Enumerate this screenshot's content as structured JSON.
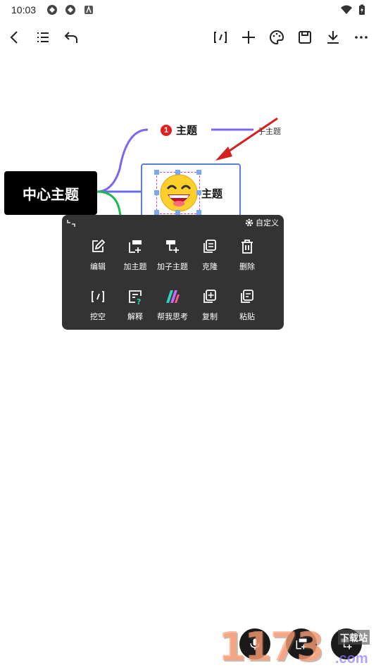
{
  "status_bar": {
    "time": "10:03"
  },
  "mindmap": {
    "central_topic": "中心主题",
    "topic_top": "主题",
    "topic_top_badge": "1",
    "subtopic": "子主题",
    "topic_selected": "主题"
  },
  "context_menu": {
    "customize_label": "自定义",
    "row1": [
      "编辑",
      "加主题",
      "加子主题",
      "克隆",
      "删除"
    ],
    "row2": [
      "挖空",
      "解释",
      "帮我思考",
      "复制",
      "粘贴"
    ]
  },
  "watermark": {
    "text": "1173",
    "site": "下载站",
    "domain": ".com"
  },
  "colors": {
    "menu_bg": "#333333",
    "accent_blue": "#5a7fd6",
    "branch_purple": "#7b68ee",
    "branch_green": "#1db954",
    "arrow_red": "#d32020"
  }
}
